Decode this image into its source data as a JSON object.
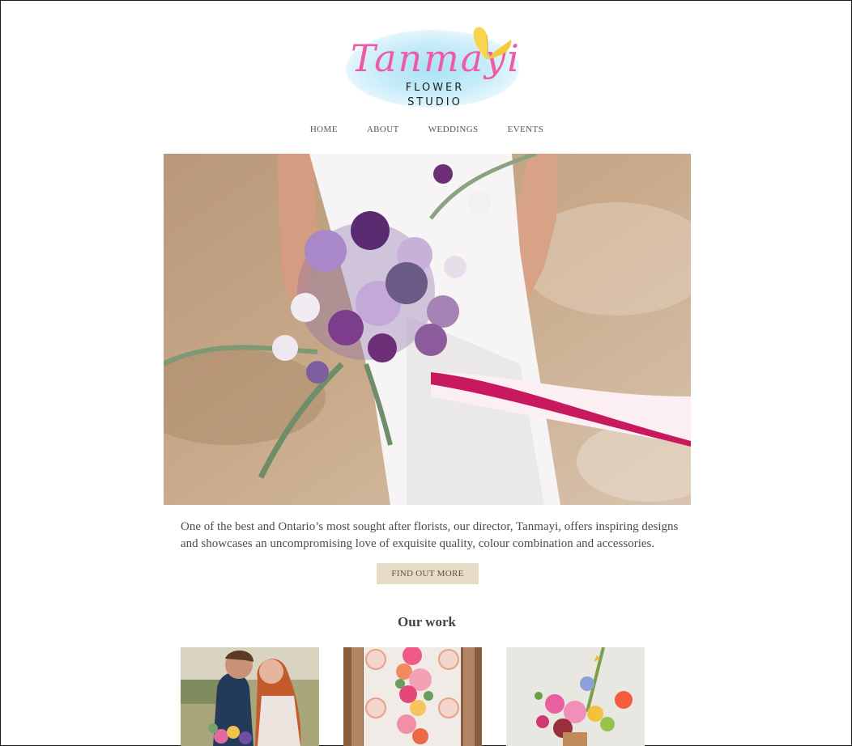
{
  "brand": {
    "script_name": "Tanmayi",
    "line1": "FLOWER",
    "line2": "STUDIO",
    "accent_pink": "#ec5ba3",
    "wash_blue": "#a9e2f5",
    "butterfly_yellow": "#f7d54c"
  },
  "nav": {
    "items": [
      {
        "label": "HOME"
      },
      {
        "label": "ABOUT"
      },
      {
        "label": "WEDDINGS"
      },
      {
        "label": "EVENTS"
      }
    ]
  },
  "hero": {
    "image": "bride-holding-purple-bouquet"
  },
  "intro": {
    "text": "One of the best and Ontario’s most sought after florists, our director, Tanmayi, offers inspiring designs and showcases an uncompromising love of exquisite quality, colour combination and accessories.",
    "button_label": "FIND OUT MORE",
    "button_color": "#e6dcc6"
  },
  "work": {
    "title": "Our work",
    "items": [
      {
        "image": "couple-with-bouquet"
      },
      {
        "image": "table-centerpiece"
      },
      {
        "image": "floral-arrangement"
      }
    ]
  }
}
